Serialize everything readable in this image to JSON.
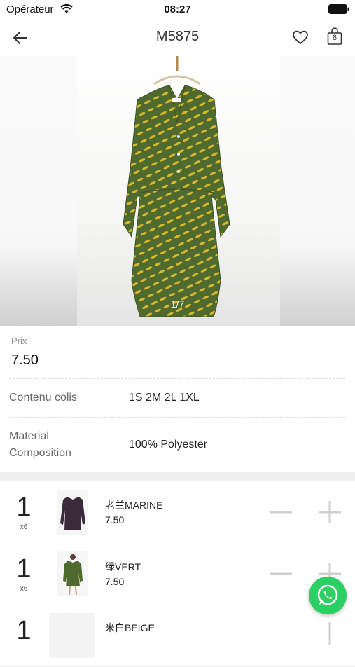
{
  "status_bar": {
    "carrier": "Opérateur",
    "time": "08:27"
  },
  "header": {
    "title": "M5875",
    "cart_count": "8"
  },
  "gallery": {
    "counter": "1/7"
  },
  "price": {
    "label": "Prix",
    "value": "7.50"
  },
  "details": [
    {
      "label": "Contenu colis",
      "value": "1S 2M 2L 1XL"
    },
    {
      "label": "Material Composition",
      "value": "100% Polyester"
    }
  ],
  "variants": [
    {
      "qty": "1",
      "multiplier": "x6",
      "name": "老兰MARINE",
      "price": "7.50"
    },
    {
      "qty": "1",
      "multiplier": "x6",
      "name": "绿VERT",
      "price": "7.50"
    },
    {
      "qty": "1",
      "multiplier": "",
      "name": "米白BEIGE",
      "price": ""
    }
  ],
  "colors": {
    "accent_green": "#2ccf64",
    "dress_green": "#4f6a2e",
    "dress_yellow": "#d9b82a",
    "marine": "#3a2a3c"
  }
}
